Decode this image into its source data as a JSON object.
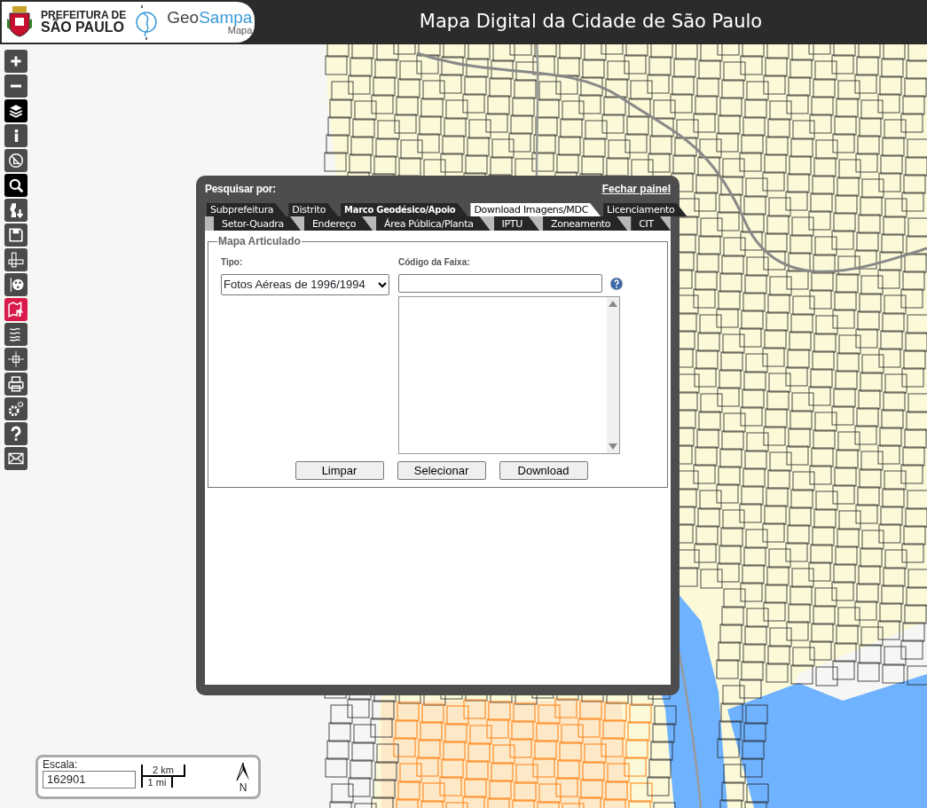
{
  "header": {
    "org_line_1": "PREFEITURA DE",
    "org_line_2": "SÃO PAULO",
    "app_name_1": "Geo",
    "app_name_2": "Sampa",
    "app_sub": "Mapa",
    "title": "Mapa Digital da Cidade de São Paulo"
  },
  "toolbar": [
    {
      "selected": false,
      "highlighted": false
    },
    {
      "selected": false,
      "highlighted": false
    },
    {
      "selected": true,
      "highlighted": false
    },
    {
      "selected": false,
      "highlighted": false
    },
    {
      "selected": false,
      "highlighted": false
    },
    {
      "selected": true,
      "highlighted": false
    },
    {
      "selected": false,
      "highlighted": false
    },
    {
      "selected": false,
      "highlighted": false
    },
    {
      "selected": false,
      "highlighted": false
    },
    {
      "selected": false,
      "highlighted": false
    },
    {
      "selected": false,
      "highlighted": true
    },
    {
      "selected": false,
      "highlighted": false
    },
    {
      "selected": false,
      "highlighted": false
    },
    {
      "selected": false,
      "highlighted": false
    },
    {
      "selected": false,
      "highlighted": false
    },
    {
      "selected": false,
      "highlighted": false
    },
    {
      "selected": false,
      "highlighted": false
    }
  ],
  "panel": {
    "title": "Pesquisar por:",
    "close_link": "Fechar painel",
    "tabs": [
      {
        "label": "Subprefeitura",
        "selected": false
      },
      {
        "label": "Distrito",
        "selected": false
      },
      {
        "label": "Marco Geodésico/Apoio",
        "selected": false
      },
      {
        "label": "Download Imagens/MDC",
        "selected": true
      },
      {
        "label": "Licenciamento",
        "selected": false
      }
    ],
    "subtabs": [
      {
        "label": "Setor-Quadra",
        "selected": false
      },
      {
        "label": "Endereço",
        "selected": false
      },
      {
        "label": "Área Pública/Planta",
        "selected": false
      },
      {
        "label": "IPTU",
        "selected": false
      },
      {
        "label": "Zoneamento",
        "selected": false
      },
      {
        "label": "CIT",
        "selected": false
      }
    ],
    "section": {
      "legend": "Mapa Articulado",
      "tipo_label": "Tipo:",
      "tipo_value": "Fotos Aéreas de 1996/1994",
      "codigo_label": "Código da Faixa:",
      "buttons": [
        "Limpar",
        "Selecionar",
        "Download"
      ]
    }
  },
  "scale": {
    "label": "Escala:",
    "value": "162901",
    "bar_top": "2 km",
    "bar_bottom": "1 mi",
    "north": "N"
  }
}
